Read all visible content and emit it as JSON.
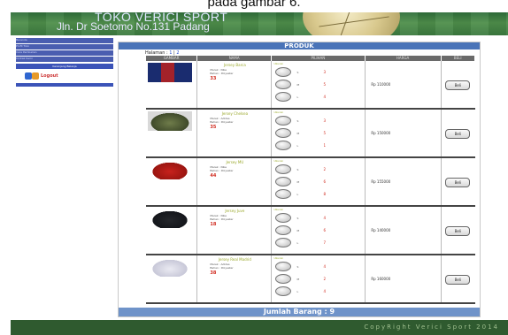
{
  "caption": "pada gambar 6.",
  "header": {
    "store_name": "TOKO VERICI SPORT",
    "address": "Jln. Dr Soetomo No.131 Padang"
  },
  "sidebar": {
    "items": [
      "Beranda",
      "Profil Toko",
      "Cara Pembelian",
      "Kontak Kami"
    ],
    "cart_label": "Keranjang Belanja",
    "logo_text": "Logout"
  },
  "panel": {
    "title": "PRODUK",
    "pagination": {
      "label": "Halaman : ",
      "page1": "1",
      "separator": " | ",
      "page2": "2"
    },
    "columns": [
      "GAMBAR",
      "NAMA",
      "PILIHAN",
      "HARGA",
      "BELI"
    ],
    "footer": "Jumlah Barang : 9"
  },
  "products": [
    {
      "name": "Jersey Barca",
      "spec1": "Merek : Nike",
      "spec2": "Bahan : Polyester",
      "stok": "33",
      "options_title": "Ukuran",
      "options": [
        {
          "size": "S",
          "qty": "3"
        },
        {
          "size": "M",
          "qty": "5"
        },
        {
          "size": "L",
          "qty": "4"
        }
      ],
      "price": "Rp 110000",
      "buy": "Beli"
    },
    {
      "name": "Jersey Chelsea",
      "spec1": "Merek : Adidas",
      "spec2": "Bahan : Polyester",
      "stok": "35",
      "options_title": "Ukuran",
      "options": [
        {
          "size": "S",
          "qty": "3"
        },
        {
          "size": "M",
          "qty": "5"
        },
        {
          "size": "L",
          "qty": "1"
        }
      ],
      "price": "Rp 150000",
      "buy": "Beli"
    },
    {
      "name": "Jersey MU",
      "spec1": "Merek : Nike",
      "spec2": "Bahan : Polyester",
      "stok": "44",
      "options_title": "Ukuran",
      "options": [
        {
          "size": "S",
          "qty": "2"
        },
        {
          "size": "M",
          "qty": "6"
        },
        {
          "size": "L",
          "qty": "8"
        }
      ],
      "price": "Rp 155000",
      "buy": "Beli"
    },
    {
      "name": "Jersey Juve",
      "spec1": "Merek : Nike",
      "spec2": "Bahan : Polyester",
      "stok": "18",
      "options_title": "Ukuran",
      "options": [
        {
          "size": "S",
          "qty": "4"
        },
        {
          "size": "M",
          "qty": "6"
        },
        {
          "size": "L",
          "qty": "7"
        }
      ],
      "price": "Rp 140000",
      "buy": "Beli"
    },
    {
      "name": "Jersey Real Madrid",
      "spec1": "Merek : Adidas",
      "spec2": "Bahan : Polyester",
      "stok": "38",
      "options_title": "Ukuran",
      "options": [
        {
          "size": "S",
          "qty": "4"
        },
        {
          "size": "M",
          "qty": "2"
        },
        {
          "size": "L",
          "qty": "4"
        }
      ],
      "price": "Rp 160000",
      "buy": "Beli"
    }
  ],
  "bottom": {
    "copyright": "CopyRight Verici Sport 2014"
  }
}
